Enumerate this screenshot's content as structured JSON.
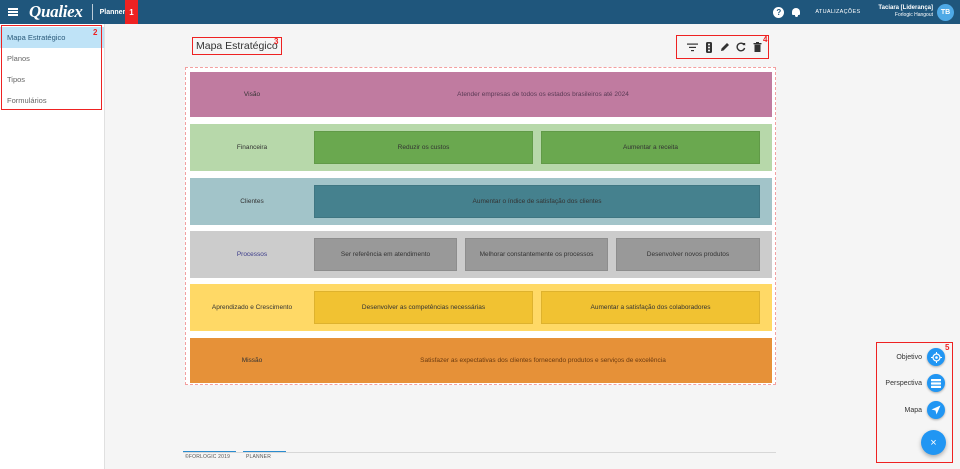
{
  "header": {
    "logo": "Qualiex",
    "module": "Planner",
    "updates_label": "ATUALIZAÇÕES",
    "user_name": "Taciara [Liderança]",
    "user_org": "Forlogic Hangout",
    "avatar_initials": "TB",
    "help_glyph": "?"
  },
  "sidebar": {
    "items": [
      {
        "label": "Mapa Estratégico",
        "active": true
      },
      {
        "label": "Planos",
        "active": false
      },
      {
        "label": "Tipos",
        "active": false
      },
      {
        "label": "Formulários",
        "active": false
      }
    ]
  },
  "main": {
    "title": "Mapa Estratégico",
    "toolbar_icons": [
      "filter-icon",
      "bullets-icon",
      "edit-icon",
      "refresh-icon",
      "delete-icon"
    ]
  },
  "map": {
    "rows": [
      {
        "label": "Visão",
        "color": "#c07ba0",
        "items": [
          "Atender empresas de todos os estados brasileiros até 2024"
        ]
      },
      {
        "label": "Financeira",
        "color": "#b7d8aa",
        "box_color": "#6aa84f",
        "items": [
          "Reduzir os custos",
          "Aumentar a receita"
        ]
      },
      {
        "label": "Clientes",
        "color": "#a2c4c9",
        "box_color": "#45818e",
        "items": [
          "Aumentar o índice de satisfação dos clientes"
        ]
      },
      {
        "label": "Processos",
        "color": "#cccccc",
        "box_color": "#999999",
        "items": [
          "Ser referência em atendimento",
          "Melhorar constantemente os processos",
          "Desenvolver novos produtos"
        ]
      },
      {
        "label": "Aprendizado e Crescimento",
        "color": "#ffd966",
        "box_color": "#f1c232",
        "items": [
          "Desenvolver as competências necessárias",
          "Aumentar a satisfação dos colaboradores"
        ]
      },
      {
        "label": "Missão",
        "color": "#e69138",
        "items": [
          "Satisfazer as expectativas dos clientes fornecendo produtos e serviços de excelência"
        ]
      }
    ]
  },
  "footer": {
    "left": "©FORLOGIC 2019",
    "right": "PLANNER"
  },
  "fab": {
    "items": [
      {
        "label": "Objetivo",
        "icon": "target-icon"
      },
      {
        "label": "Perspectiva",
        "icon": "layers-icon"
      },
      {
        "label": "Mapa",
        "icon": "send-icon"
      }
    ],
    "main_glyph": "×"
  },
  "annotations": [
    "1",
    "2",
    "3",
    "4",
    "5"
  ],
  "colors": {
    "topbar": "#1f567c",
    "accent": "#2196f3",
    "annotation": "#ee2222",
    "sidebar_active": "#bfe3f7"
  }
}
